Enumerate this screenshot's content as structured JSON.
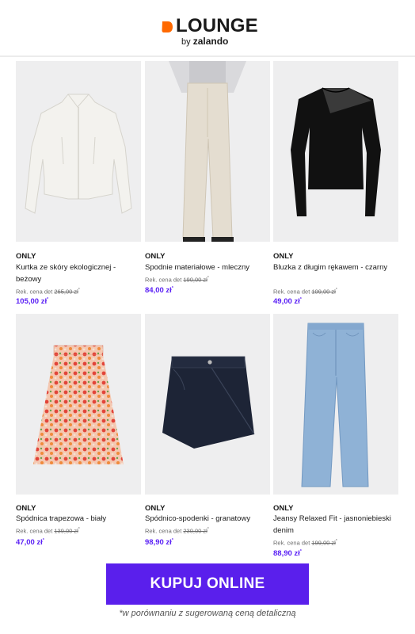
{
  "header": {
    "logo_word": "LOUNGE",
    "logo_by": "by",
    "logo_brand": "zalando",
    "accent_color": "#ff6900"
  },
  "products": [
    {
      "brand": "ONLY",
      "name": "Kurtka ze skóry ekologicznej - beżowy",
      "rrp_label": "Rek. cena det",
      "rrp": "265,00 zł",
      "price": "105,00 zł",
      "image_icon": "jacket-icon"
    },
    {
      "brand": "ONLY",
      "name": "Spodnie materiałowe - mleczny",
      "rrp_label": "Rek. cena det",
      "rrp": "190,00 zł",
      "price": "84,00 zł",
      "image_icon": "trousers-icon"
    },
    {
      "brand": "ONLY",
      "name": "Bluzka z długim rękawem - czarny",
      "rrp_label": "Rek. cena det",
      "rrp": "109,00 zł",
      "price": "49,00 zł",
      "image_icon": "blouse-icon"
    },
    {
      "brand": "ONLY",
      "name": "Spódnica trapezowa - biały",
      "rrp_label": "Rek. cena det",
      "rrp": "139,00 zł",
      "price": "47,00 zł",
      "image_icon": "skirt-icon"
    },
    {
      "brand": "ONLY",
      "name": "Spódnico-spodenki - granatowy",
      "rrp_label": "Rek. cena det",
      "rrp": "230,00 zł",
      "price": "98,90 zł",
      "image_icon": "skort-icon"
    },
    {
      "brand": "ONLY",
      "name": "Jeansy Relaxed Fit - jasnoniebieski denim",
      "rrp_label": "Rek. cena det",
      "rrp": "199,00 zł",
      "price": "88,90 zł",
      "image_icon": "jeans-icon"
    }
  ],
  "cta": {
    "label": "KUPUJ ONLINE",
    "color": "#5a1fec"
  },
  "price_color": "#5b21f5",
  "footnote": "*w porównaniu z sugerowaną ceną detaliczną"
}
